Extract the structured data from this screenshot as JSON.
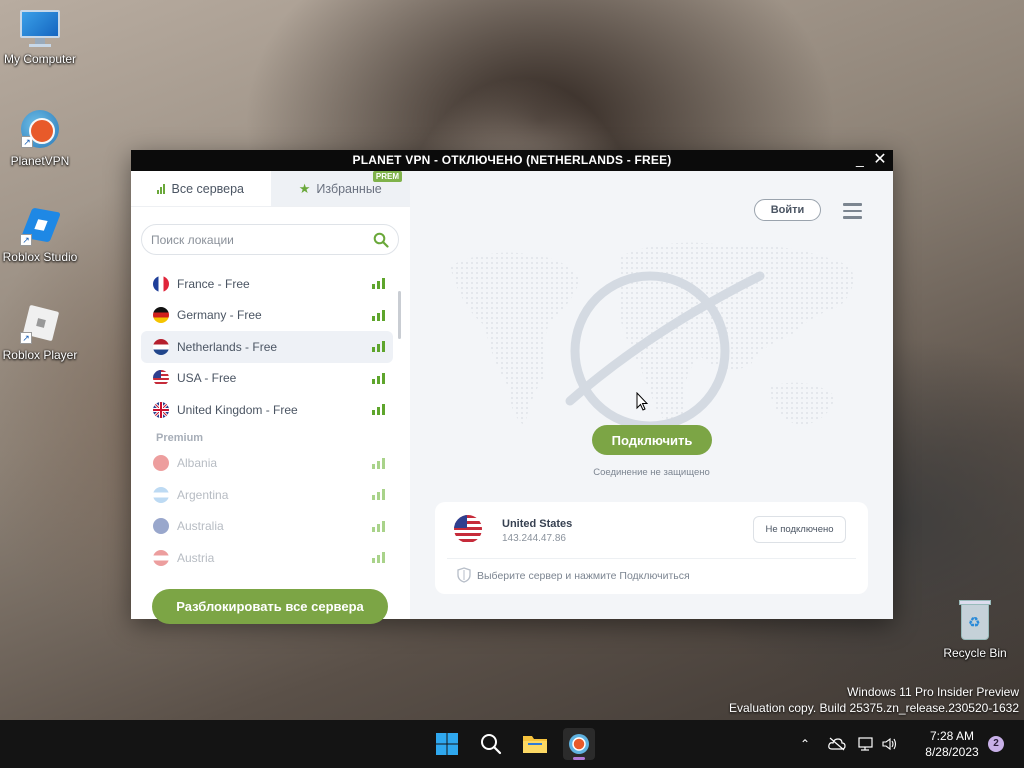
{
  "desktop": {
    "icons": [
      {
        "label": "My Computer",
        "icon": "monitor-icon"
      },
      {
        "label": "PlanetVPN",
        "icon": "planetvpn-icon"
      },
      {
        "label": "Roblox Studio",
        "icon": "roblox-studio-icon"
      },
      {
        "label": "Roblox Player",
        "icon": "roblox-player-icon"
      },
      {
        "label": "Recycle Bin",
        "icon": "recycle-bin-icon"
      }
    ],
    "watermark": {
      "line1": "Windows 11 Pro Insider Preview",
      "line2": "Evaluation copy. Build 25375.zn_release.230520-1632"
    }
  },
  "window": {
    "title": "PLANET VPN - ОТКЛЮЧЕНО (NETHERLANDS - FREE)",
    "controls": {
      "minimize": "_",
      "close": "✕"
    }
  },
  "sidebar": {
    "tabs": [
      {
        "label": "Все сервера",
        "active": true
      },
      {
        "label": "Избранные",
        "badge": "PREM"
      }
    ],
    "search_placeholder": "Поиск локации",
    "free_servers": [
      {
        "name": "France - Free",
        "flag": "france"
      },
      {
        "name": "Germany - Free",
        "flag": "germany"
      },
      {
        "name": "Netherlands - Free",
        "flag": "netherlands",
        "selected": true
      },
      {
        "name": "USA - Free",
        "flag": "usa"
      },
      {
        "name": "United Kingdom - Free",
        "flag": "uk"
      }
    ],
    "premium_heading": "Premium",
    "premium_servers": [
      {
        "name": "Albania",
        "flag": "albania"
      },
      {
        "name": "Argentina",
        "flag": "argentina"
      },
      {
        "name": "Australia",
        "flag": "australia"
      },
      {
        "name": "Austria",
        "flag": "austria"
      }
    ],
    "unlock_button": "Разблокировать все сервера"
  },
  "main": {
    "login_button": "Войти",
    "connect_button": "Подключить",
    "connection_note": "Соединение не защищено",
    "card": {
      "country": "United States",
      "ip": "143.244.47.86",
      "state": "Не подключено",
      "hint": "Выберите сервер и нажмите Подключиться"
    }
  },
  "colors": {
    "accent_green": "#7ca545",
    "signal_green": "#5ea52c",
    "titlebar": "#0b0b0b"
  },
  "taskbar": {
    "clock_time": "7:28 AM",
    "clock_date": "8/28/2023",
    "notification_count": "2"
  }
}
